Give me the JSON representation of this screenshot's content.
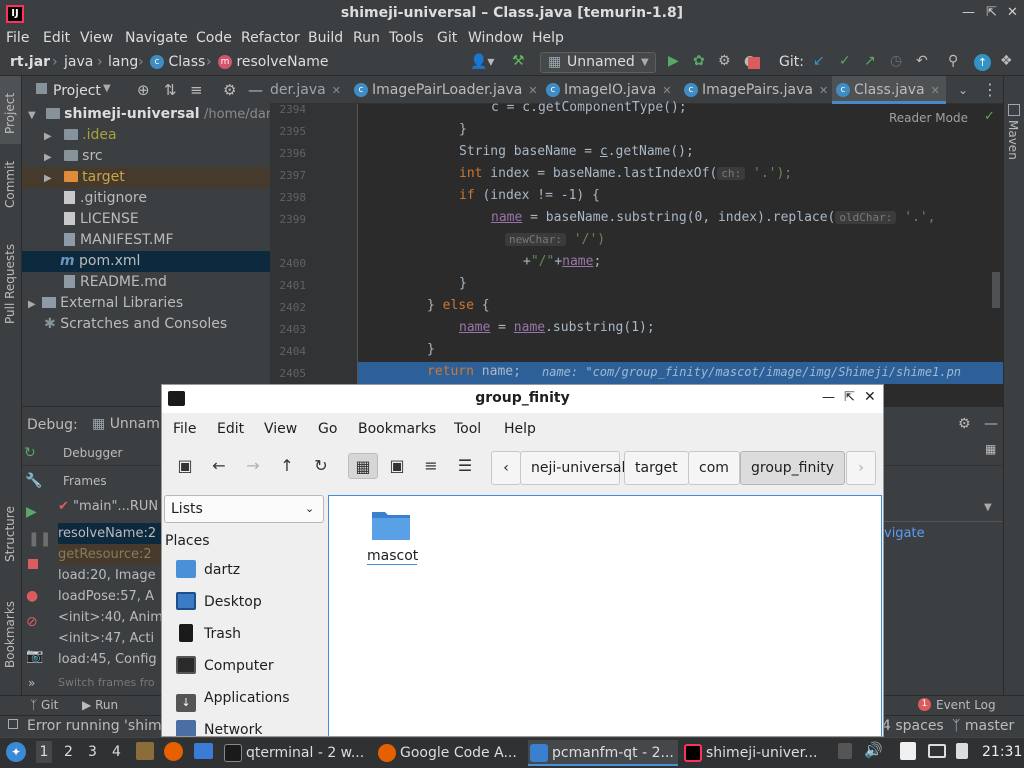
{
  "ide": {
    "window_title": "shimeji-universal – Class.java [temurin-1.8]",
    "app_logo_text": "IJ",
    "menu": [
      "File",
      "Edit",
      "View",
      "Navigate",
      "Code",
      "Refactor",
      "Build",
      "Run",
      "Tools",
      "Git",
      "Window",
      "Help"
    ],
    "breadcrumbs": [
      "rt.jar",
      "java",
      "lang",
      "Class",
      "resolveName"
    ],
    "run_config": "Unnamed",
    "git_label": "Git:"
  },
  "project_panel": {
    "title": "Project",
    "root_name": "shimeji-universal",
    "root_path": "/home/dartz",
    "items": [
      {
        "name": ".idea",
        "kind": "folder"
      },
      {
        "name": "src",
        "kind": "folder"
      },
      {
        "name": "target",
        "kind": "folder-orange"
      },
      {
        "name": ".gitignore",
        "kind": "file"
      },
      {
        "name": "LICENSE",
        "kind": "file"
      },
      {
        "name": "MANIFEST.MF",
        "kind": "file"
      },
      {
        "name": "pom.xml",
        "kind": "maven"
      },
      {
        "name": "README.md",
        "kind": "file"
      }
    ],
    "external_libraries": "External Libraries",
    "scratches": "Scratches and Consoles"
  },
  "editor": {
    "tabs": [
      {
        "label": "der.java",
        "active": false
      },
      {
        "label": "ImagePairLoader.java",
        "active": false
      },
      {
        "label": "ImageIO.java",
        "active": false
      },
      {
        "label": "ImagePairs.java",
        "active": false
      },
      {
        "label": "Class.java",
        "active": true
      }
    ],
    "reader_mode": "Reader Mode",
    "line_numbers": [
      "2394",
      "2395",
      "2396",
      "2397",
      "2398",
      "2399",
      "2400",
      "2401",
      "2402",
      "2403",
      "2404",
      "2405"
    ],
    "code": {
      "l2394": "c = c.getComponentType();",
      "l2395": "}",
      "l2396a": "String baseName = ",
      "l2396b": "c",
      "l2396c": ".getName();",
      "l2397a": "int",
      "l2397b": " index = baseName.lastIndexOf(",
      "l2397hint": "ch:",
      "l2397c": " '.');",
      "l2398a": "if",
      "l2398b": " (index != -1) {",
      "l2399a": "name",
      "l2399b": " = baseName.substring(0, index).replace(",
      "l2399hint": "oldChar:",
      "l2399c": " '.',",
      "l2399d_hint": "newChar:",
      "l2399d": " '/')",
      "l2400a": "+",
      "l2400b": "\"/\"",
      "l2400c": "+",
      "l2400d": "name",
      "l2400e": ";",
      "l2401": "}",
      "l2402a": "} ",
      "l2402b": "else",
      "l2402c": " {",
      "l2403a": "name",
      "l2403b": " = ",
      "l2403c": "name",
      "l2403d": ".substring(1);",
      "l2404": "}",
      "l2405a": "return",
      "l2405b": " name;",
      "l2405inline": "name: \"com/group_finity/mascot/image/img/Shimeji/shime1.pn"
    }
  },
  "debug": {
    "label": "Debug:",
    "session": "Unnam",
    "tab_debugger": "Debugger",
    "frames_label": "Frames",
    "thread": "\"main\"...RUN",
    "frames": [
      "resolveName:2",
      "getResource:2",
      "load:20, Image",
      "loadPose:57, A",
      "<init>:40, Anim",
      "<init>:47, Acti",
      "load:45, Config"
    ],
    "switch_frames": "Switch frames fro",
    "navigate": "vigate"
  },
  "left_strip": [
    "Project",
    "Commit",
    "Pull Requests",
    "Structure",
    "Bookmarks"
  ],
  "right_strip": [
    "Maven"
  ],
  "bottom_tools": {
    "git": "Git",
    "run": "Run",
    "event_log": "Event Log",
    "event_count": "1"
  },
  "status": {
    "error": "Error running 'shime",
    "indent": "4 spaces",
    "branch": "master"
  },
  "file_manager": {
    "title": "group_finity",
    "menu": [
      "File",
      "Edit",
      "View",
      "Go",
      "Bookmarks",
      "Tool",
      "Help"
    ],
    "path": [
      "neji-universal",
      "target",
      "com",
      "group_finity"
    ],
    "side_select": "Lists",
    "places_label": "Places",
    "places": [
      "dartz",
      "Desktop",
      "Trash",
      "Computer",
      "Applications",
      "Network"
    ],
    "items": [
      {
        "name": "mascot"
      }
    ]
  },
  "taskbar": {
    "desktops": [
      "1",
      "2",
      "3",
      "4"
    ],
    "tasks": [
      {
        "label": "qterminal - 2 w...",
        "active": false
      },
      {
        "label": "Google Code A...",
        "active": false
      },
      {
        "label": "pcmanfm-qt - 2...",
        "active": true
      },
      {
        "label": "shimeji-univer...",
        "active": false
      }
    ],
    "clock": "21:31"
  }
}
